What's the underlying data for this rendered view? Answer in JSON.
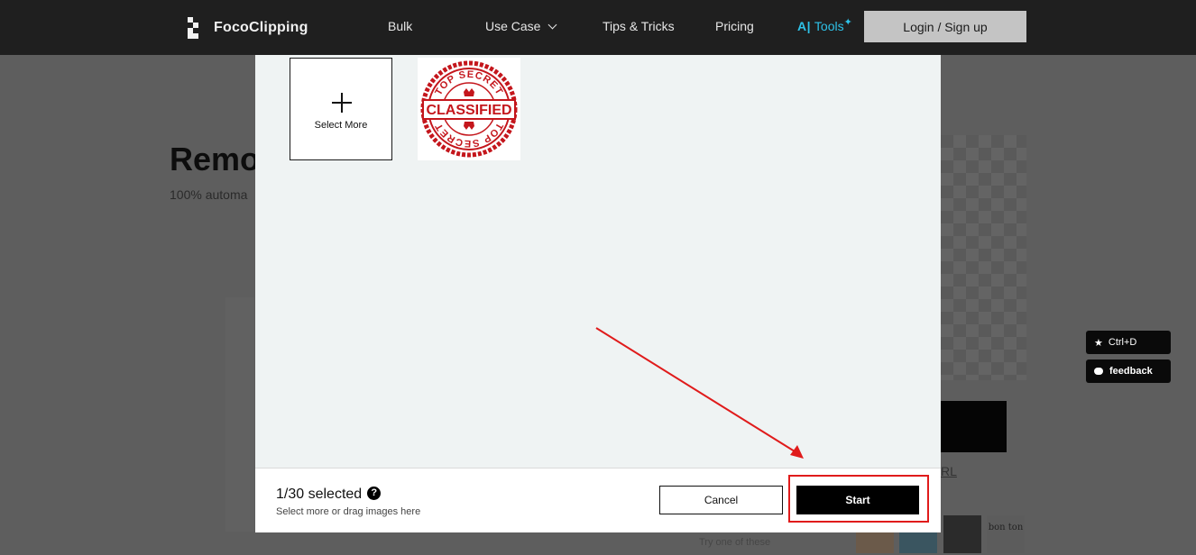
{
  "nav": {
    "brand": "FocoClipping",
    "items": [
      "Bulk",
      "Use Case",
      "Tips & Tricks",
      "Pricing"
    ],
    "ai_tools_label": "Tools",
    "login_label": "Login / Sign up"
  },
  "background": {
    "title": "Remo",
    "subtitle": "100% automa",
    "url_link": "RL",
    "try_label": "Try one of these",
    "thumb_text": "bon ton"
  },
  "side_buttons": {
    "bookmark_label": "Ctrl+D",
    "feedback_label": "feedback"
  },
  "modal": {
    "select_more_label": "Select More",
    "thumbnail": {
      "stamp_top": "TOP SECRET",
      "stamp_center": "CLASSIFIED",
      "stamp_bottom": "TOP SECRET"
    },
    "footer": {
      "count_text": "1/30 selected",
      "help_glyph": "?",
      "hint": "Select more or drag images here",
      "cancel_label": "Cancel",
      "start_label": "Start"
    }
  },
  "colors": {
    "accent_ai": "#2ec2e8",
    "annotation_red": "#e01b1b",
    "modal_bg": "#eff3f3",
    "overlay_dim": "#5e5e5e"
  },
  "icons": [
    "plus-icon",
    "help-icon",
    "chevron-down-icon",
    "sparkle-icon",
    "star-icon",
    "chat-bubble-icon"
  ]
}
